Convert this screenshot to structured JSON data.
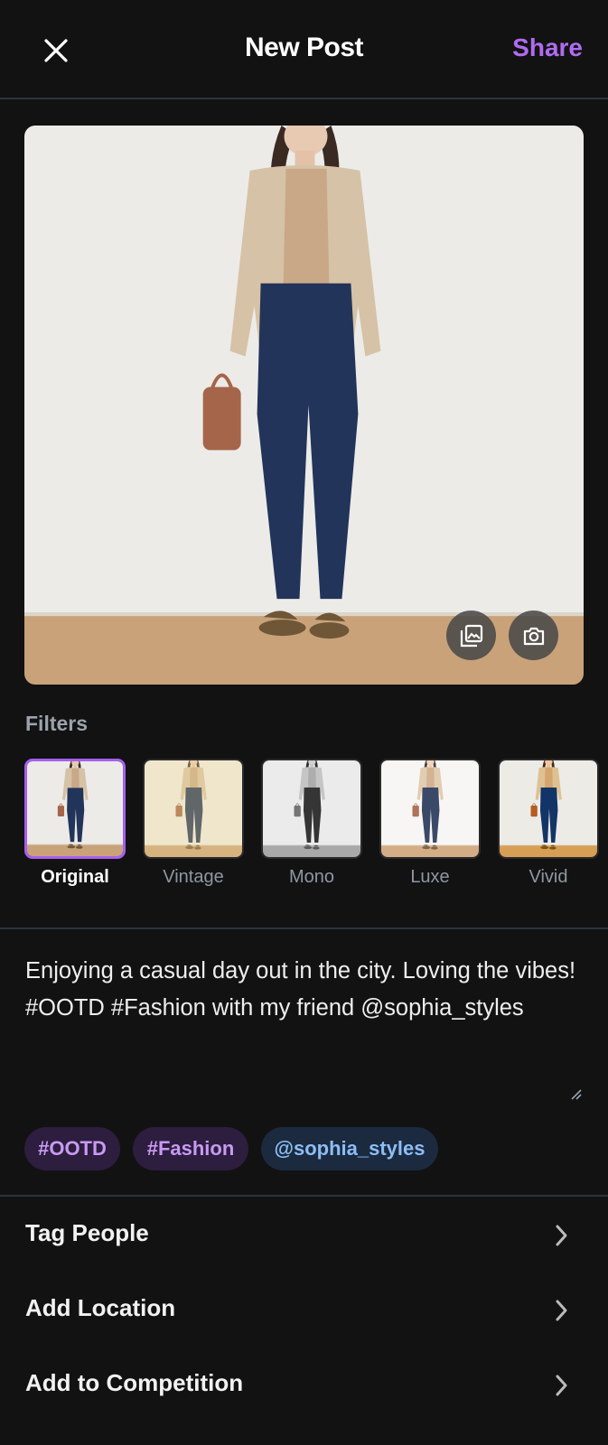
{
  "header": {
    "title": "New Post",
    "share_label": "Share",
    "close_icon": "close-icon"
  },
  "photo": {
    "gallery_icon": "gallery-icon",
    "camera_icon": "camera-icon"
  },
  "filters": {
    "label": "Filters",
    "selected": "Original",
    "items": [
      {
        "name": "Original"
      },
      {
        "name": "Vintage"
      },
      {
        "name": "Mono"
      },
      {
        "name": "Luxe"
      },
      {
        "name": "Vivid"
      }
    ]
  },
  "caption": {
    "text": "Enjoying a casual day out in the city. Loving the vibes! #OOTD #Fashion with my friend @sophia_styles"
  },
  "chips": [
    {
      "label": "#OOTD",
      "kind": "hashtag"
    },
    {
      "label": "#Fashion",
      "kind": "hashtag"
    },
    {
      "label": "@sophia_styles",
      "kind": "mention"
    }
  ],
  "options": [
    {
      "label": "Tag People"
    },
    {
      "label": "Add Location"
    },
    {
      "label": "Add to Competition"
    }
  ],
  "colors": {
    "background": "#121212",
    "accent": "#b06cf0",
    "hashtag_chip_bg": "#2d1d3e",
    "hashtag_chip_text": "#c89af2",
    "mention_chip_bg": "#1b2a3f",
    "mention_chip_text": "#8dbdf5",
    "divider": "#2b3440"
  }
}
